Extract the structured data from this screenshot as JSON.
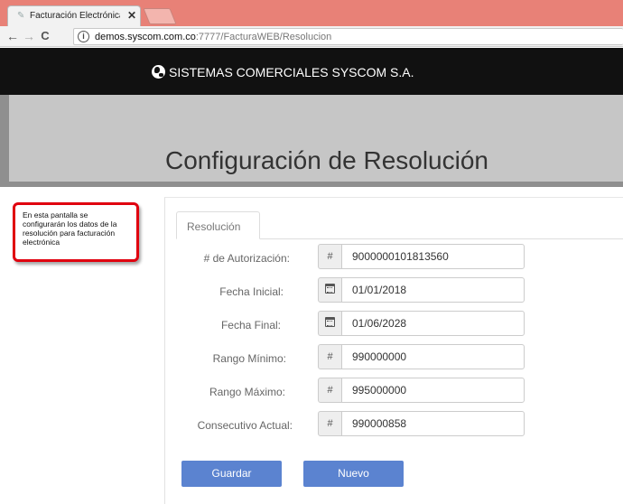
{
  "browser": {
    "tab_title": "Facturación Electrónica C",
    "tab_close": "✕",
    "nav_back": "←",
    "nav_forward": "→",
    "nav_reload": "C",
    "url_info": "i",
    "url_host": "demos.syscom.com.co",
    "url_path": ":7777/FacturaWEB/Resolucion"
  },
  "header": {
    "brand": "SISTEMAS COMERCIALES SYSCOM S.A."
  },
  "page": {
    "title": "Configuración de Resolución"
  },
  "note": {
    "text": "En esta pantalla se configurarán los datos de la resolución para facturación electrónica"
  },
  "form": {
    "tab_label": "Resolución",
    "fields": [
      {
        "label": "# de Autorización:",
        "addon": "#",
        "value": "9000000101813560"
      },
      {
        "label": "Fecha Inicial:",
        "addon": "calendar-icon",
        "value": "01/01/2018"
      },
      {
        "label": "Fecha Final:",
        "addon": "calendar-icon",
        "value": "01/06/2028"
      },
      {
        "label": "Rango Mínimo:",
        "addon": "#",
        "value": "990000000"
      },
      {
        "label": "Rango Máximo:",
        "addon": "#",
        "value": "995000000"
      },
      {
        "label": "Consecutivo Actual:",
        "addon": "#",
        "value": "990000858"
      }
    ],
    "save_label": "Guardar",
    "new_label": "Nuevo"
  },
  "colors": {
    "tab_strip": "#e88177",
    "header_bg": "#111111",
    "banner_bg": "#c6c6c6",
    "button_bg": "#5b83d0",
    "note_border": "#e0000f"
  }
}
